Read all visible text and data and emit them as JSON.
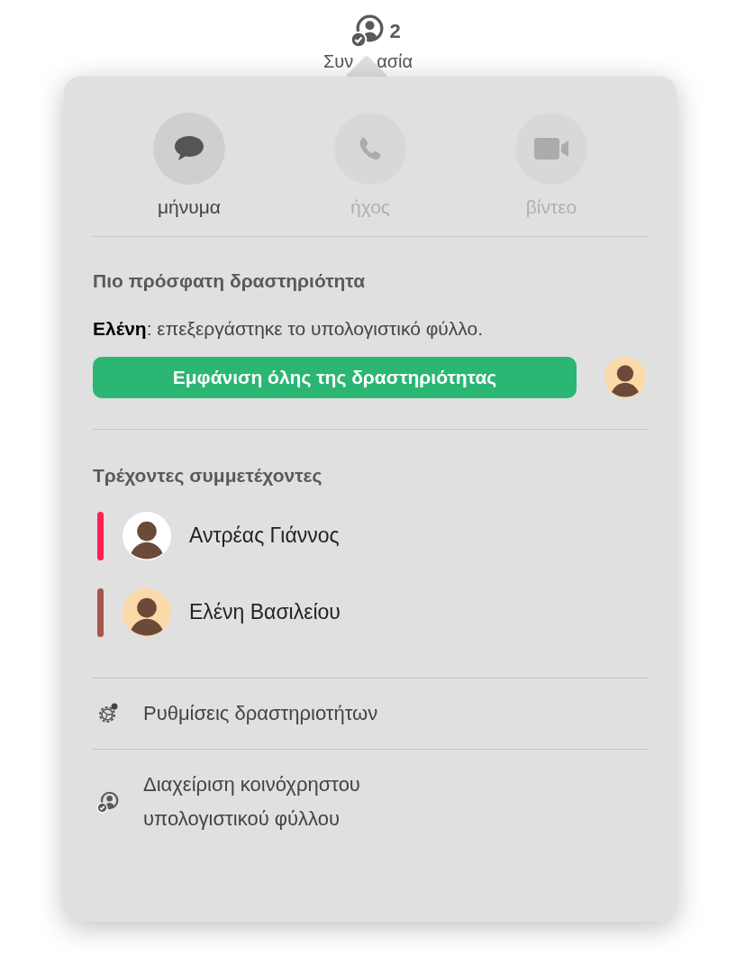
{
  "toolbar": {
    "count": "2",
    "label_parts": [
      "Συν",
      "ασία"
    ]
  },
  "actions": [
    {
      "kind": "message",
      "label": "μήνυμα",
      "disabled": false
    },
    {
      "kind": "audio",
      "label": "ήχος",
      "disabled": true
    },
    {
      "kind": "video",
      "label": "βίντεο",
      "disabled": true
    }
  ],
  "recent_activity": {
    "heading": "Πιο πρόσφατη δραστηριότητα",
    "text": "**Ελένη**: επεξεργάστηκε το υπολογιστικό φύλλο.",
    "button": "Εμφάνιση όλης της δραστηριότητας"
  },
  "participants": {
    "heading": "Τρέχοντες συμμετέχοντες",
    "items": [
      {
        "name": "Αντρέας Γιάννος",
        "color": "#ff1f55"
      },
      {
        "name": "Ελένη Βασιλείου",
        "color": "#a8554a"
      }
    ]
  },
  "menu": [
    {
      "kind": "settings",
      "label": "Ρυθμίσεις δραστηριοτήτων"
    },
    {
      "kind": "manage",
      "label": "Διαχείριση κοινόχρηστου υπολογιστικού φύλλου"
    }
  ]
}
